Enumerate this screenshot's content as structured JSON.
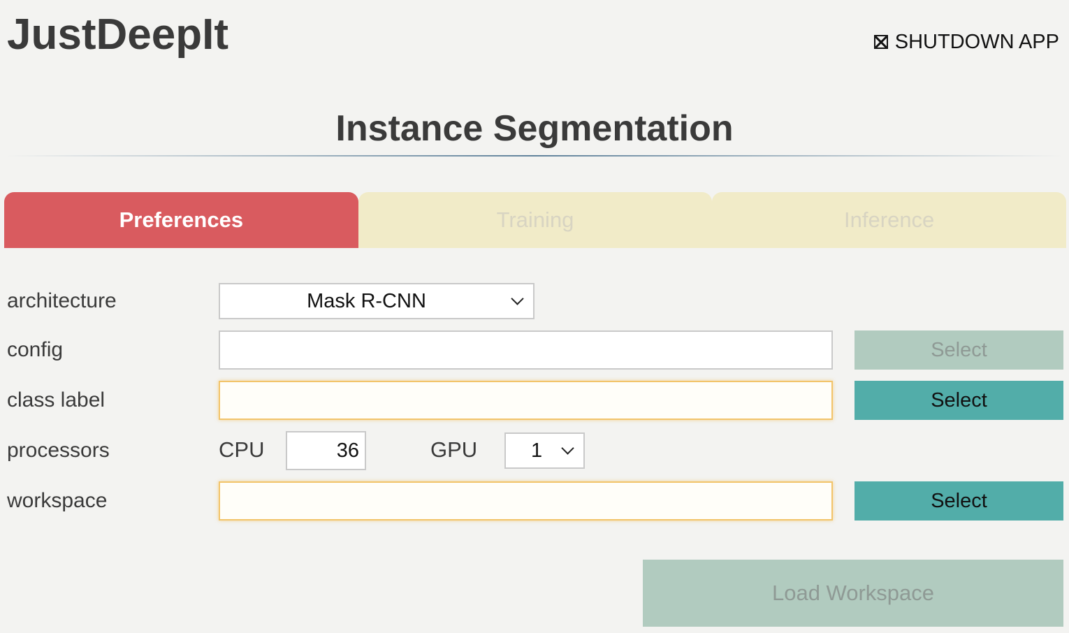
{
  "app": {
    "title": "JustDeepIt",
    "shutdown_label": "SHUTDOWN APP"
  },
  "page": {
    "heading": "Instance Segmentation"
  },
  "tabs": [
    {
      "label": "Preferences",
      "active": true
    },
    {
      "label": "Training",
      "active": false
    },
    {
      "label": "Inference",
      "active": false
    }
  ],
  "form": {
    "architecture": {
      "label": "architecture",
      "selected": "Mask R-CNN"
    },
    "config": {
      "label": "config",
      "value": "",
      "button_label": "Select",
      "button_enabled": false
    },
    "class_label": {
      "label": "class label",
      "value": "",
      "button_label": "Select",
      "button_enabled": true
    },
    "processors": {
      "label": "processors",
      "cpu_label": "CPU",
      "cpu_value": "36",
      "gpu_label": "GPU",
      "gpu_value": "1"
    },
    "workspace": {
      "label": "workspace",
      "value": "",
      "button_label": "Select",
      "button_enabled": true
    }
  },
  "actions": {
    "load_workspace_label": "Load Workspace",
    "load_workspace_enabled": false
  },
  "colors": {
    "background": "#f3f3f1",
    "tab_active": "#d95b5f",
    "tab_inactive": "#f1ebc8",
    "button_enabled": "#52ada9",
    "button_disabled": "#b1cbbf",
    "input_highlight_border": "#f2c46a"
  },
  "icons": {
    "shutdown": "close-box-icon",
    "dropdown": "chevron-down-icon"
  }
}
